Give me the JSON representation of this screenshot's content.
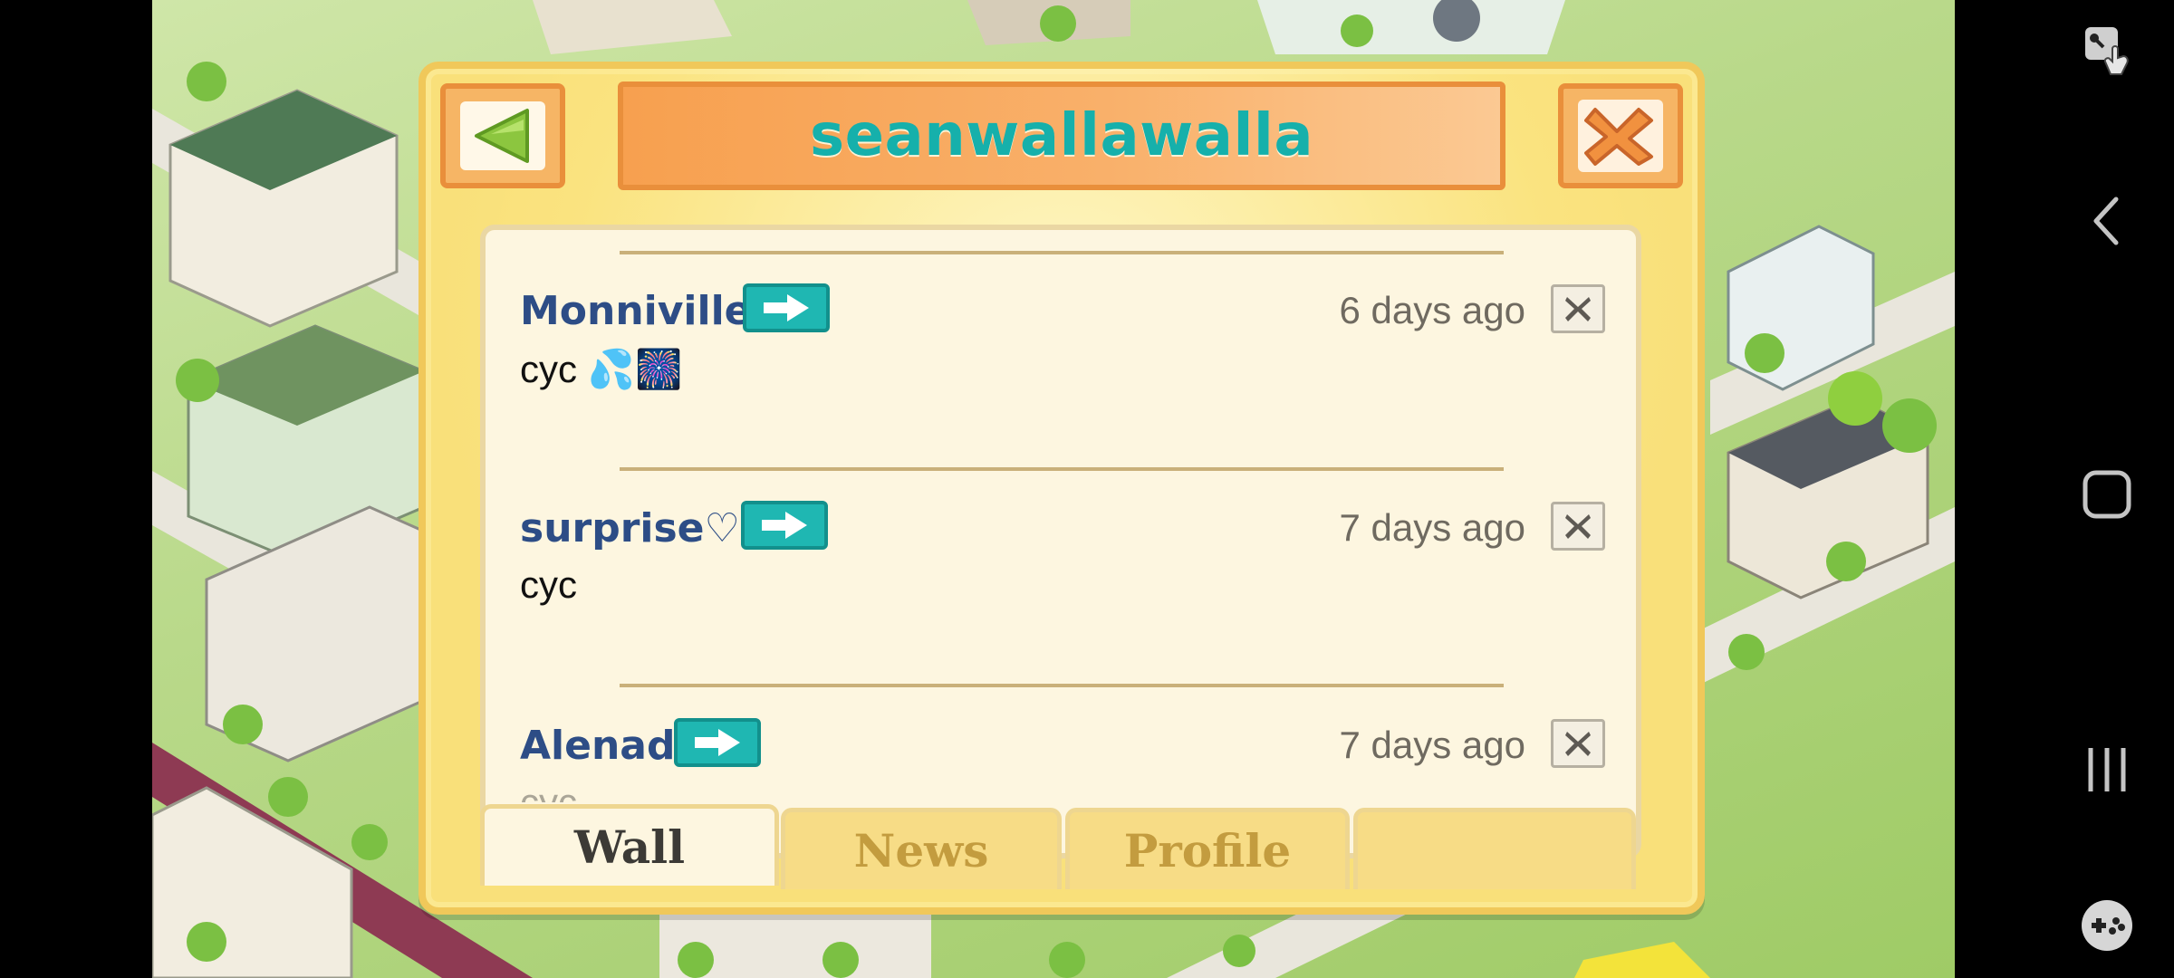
{
  "dialog": {
    "title": "seanwallawalla"
  },
  "posts": [
    {
      "author": "Monniville",
      "time": "6 days ago",
      "message": "cyc 💦🎆"
    },
    {
      "author": "surprise♡",
      "time": "7 days ago",
      "message": "cyc"
    },
    {
      "author": "Alenad",
      "time": "7 days ago",
      "message": "cyc"
    }
  ],
  "tabs": [
    {
      "label": "Wall",
      "active": true
    },
    {
      "label": "News",
      "active": false
    },
    {
      "label": "Profile",
      "active": false
    },
    {
      "label": "",
      "active": false
    }
  ],
  "icons": {
    "back": "back-arrow-icon",
    "close": "close-x-icon",
    "visit": "right-arrow-icon",
    "delete": "x-icon",
    "nav": [
      "screenshot-tool-icon",
      "back-chevron-icon",
      "home-square-icon",
      "recent-apps-icon",
      "game-controller-icon"
    ]
  },
  "colors": {
    "title_text": "#16b0ab",
    "author_text": "#2d4d86",
    "visit_button": "#1fb7b2",
    "dialog_bg": "#f9e07a",
    "panel_bg": "#fdf6e0"
  }
}
